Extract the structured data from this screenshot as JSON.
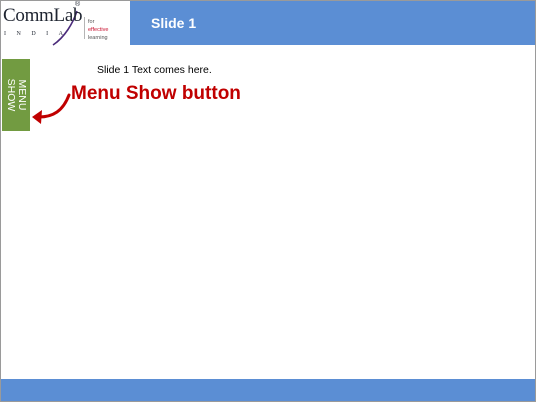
{
  "logo": {
    "brand": "CommLab",
    "registered_mark": "®",
    "sub": "INDIA",
    "tagline_line1": "for",
    "tagline_accent": "effective",
    "tagline_rest": " learning"
  },
  "header": {
    "title": "Slide 1"
  },
  "menu_button": {
    "line1": "MENU",
    "line2": "SHOW"
  },
  "slide": {
    "body_text": "Slide 1 Text comes here.",
    "annotation": "Menu Show button"
  },
  "colors": {
    "header_blue": "#5b8ed4",
    "menu_green": "#729b41",
    "annotation_red": "#c00000"
  }
}
